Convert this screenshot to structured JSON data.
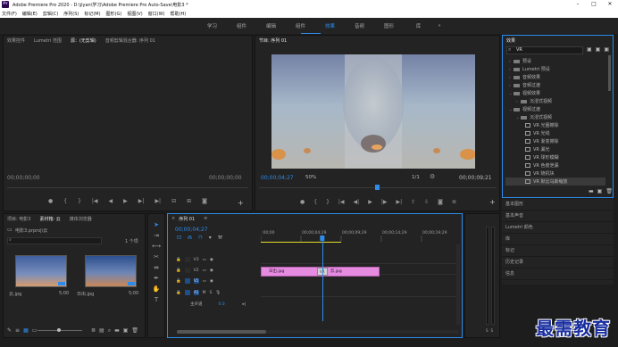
{
  "window": {
    "title": "Adobe Premiere Pro 2020 - D:\\jiyan\\学习\\Adobe Premiere Pro Auto-Save\\电影3 *",
    "app_icon": "Pr"
  },
  "menu": [
    "文件(F)",
    "编辑(E)",
    "剪辑(C)",
    "序列(S)",
    "标记(M)",
    "图形(G)",
    "视图(V)",
    "窗口(W)",
    "帮助(H)"
  ],
  "workspaces": {
    "items": [
      "学习",
      "组件",
      "编辑",
      "组件",
      "效果",
      "音频",
      "图形",
      "库"
    ],
    "active_index": 4,
    "more": "»"
  },
  "source_panel": {
    "tabs": [
      "效果控件",
      "Lumetri 范围",
      "源：(无剪辑)",
      "音频剪辑混合器: 序列 01"
    ],
    "active_tab": 2,
    "tc_left": "00;00;00;00",
    "tc_right": "00;00;00;00"
  },
  "program_panel": {
    "title": "节目: 序列 01",
    "tc_current": "00;00;04;27",
    "zoom": "50%",
    "quality": "1/1",
    "tc_duration": "00;00;09;21"
  },
  "effects_panel": {
    "title": "效果",
    "search_value": "VR",
    "tree": [
      {
        "level": 0,
        "type": "folder",
        "label": "预设"
      },
      {
        "level": 0,
        "type": "folder",
        "label": "Lumetri 预设"
      },
      {
        "level": 0,
        "type": "folder",
        "label": "音频效果"
      },
      {
        "level": 0,
        "type": "folder",
        "label": "音频过渡"
      },
      {
        "level": 0,
        "type": "folder",
        "label": "视频效果",
        "expanded": true
      },
      {
        "level": 1,
        "type": "folder",
        "label": "沉浸式视频"
      },
      {
        "level": 0,
        "type": "folder",
        "label": "视频过渡",
        "expanded": true
      },
      {
        "level": 1,
        "type": "folder",
        "label": "沉浸式视频",
        "expanded": true
      },
      {
        "level": 2,
        "type": "fx",
        "label": "VR 光圈擦除"
      },
      {
        "level": 2,
        "type": "fx",
        "label": "VR 光线"
      },
      {
        "level": 2,
        "type": "fx",
        "label": "VR 渐变擦除"
      },
      {
        "level": 2,
        "type": "fx",
        "label": "VR 漏光"
      },
      {
        "level": 2,
        "type": "fx",
        "label": "VR 球形模糊"
      },
      {
        "level": 2,
        "type": "fx",
        "label": "VR 色度泄漏"
      },
      {
        "level": 2,
        "type": "fx",
        "label": "VR 随机块"
      },
      {
        "level": 2,
        "type": "fx",
        "label": "VR 默比乌斯缩放",
        "selected": true
      }
    ]
  },
  "side_panels": [
    "基本图形",
    "基本声音",
    "Lumetri 颜色",
    "库",
    "标记",
    "历史记录",
    "信息"
  ],
  "project_panel": {
    "tabs": [
      "项目: 电影3",
      "素材箱: 云",
      "媒体浏览器"
    ],
    "active_tab": 1,
    "path": "电影3.prproj\\云",
    "count": "1 个项",
    "items": [
      {
        "name": "云.jpg",
        "duration": "5;00"
      },
      {
        "name": "日出.jpg",
        "duration": "5;00"
      }
    ]
  },
  "timeline": {
    "title": "序列 01",
    "tc": "00;00;04;27",
    "ruler": [
      ":00;00",
      "00;00;04;29",
      "00;00;09;29",
      "00;00;14;29",
      "00;00;19;29",
      "00;00"
    ],
    "playhead": 0.31,
    "tracks": [
      {
        "name": "V3",
        "kind": "video"
      },
      {
        "name": "V2",
        "kind": "video"
      },
      {
        "name": "V1",
        "kind": "video"
      },
      {
        "name": "A1",
        "kind": "audio"
      },
      {
        "name": "主声道",
        "value": "0.0",
        "kind": "master"
      }
    ],
    "clips": [
      {
        "label": "日出.jpg",
        "track": "V2",
        "start": 0.0,
        "end": 0.31
      },
      {
        "label": "云.jpg",
        "track": "V2",
        "start": 0.31,
        "end": 0.6
      }
    ],
    "transition_label": "VR"
  },
  "watermark": "最需教育",
  "colors": {
    "accent": "#2d8ceb",
    "clip": "#e58be0",
    "panel": "#232323",
    "bg": "#1d1d1d"
  }
}
